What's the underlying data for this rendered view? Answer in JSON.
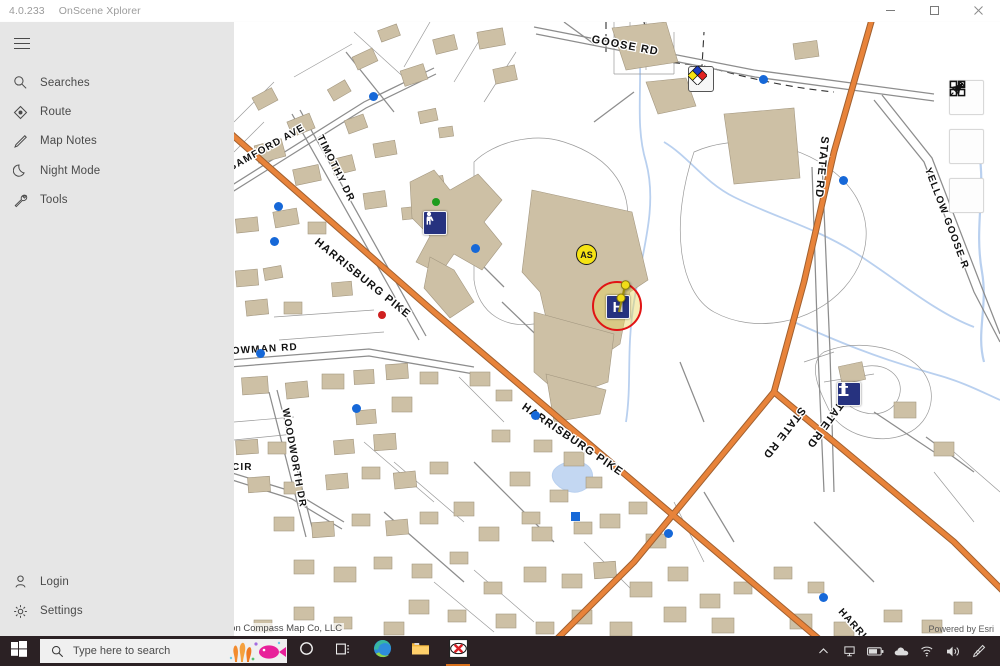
{
  "window": {
    "version": "4.0.233",
    "title": "OnScene Xplorer",
    "controls": {
      "minimize": "minimize-button",
      "maximize": "maximize-button",
      "close": "close-button"
    }
  },
  "sidebar": {
    "menu_toggle": "hamburger-menu",
    "items": [
      {
        "label": "Searches",
        "icon": "search-icon"
      },
      {
        "label": "Route",
        "icon": "route-icon"
      },
      {
        "label": "Map Notes",
        "icon": "pencil-icon"
      },
      {
        "label": "Night Mode",
        "icon": "moon-icon"
      },
      {
        "label": "Tools",
        "icon": "wrench-icon"
      }
    ],
    "bottom_items": [
      {
        "label": "Login",
        "icon": "person-icon"
      },
      {
        "label": "Settings",
        "icon": "gear-icon"
      }
    ]
  },
  "map": {
    "controls": [
      {
        "name": "locate-button",
        "icon": "navigation-arrow-icon"
      },
      {
        "name": "layers-button",
        "icon": "grid-squares-icon"
      },
      {
        "name": "pin-button",
        "icon": "pushpin-icon"
      }
    ],
    "attribution": "ron Compass Map Co, LLC",
    "powered_by": "Powered by Esri",
    "street_labels": [
      "GOOSE RD",
      "BAMFORD AVE",
      "TIMOTHY DR",
      "HARRISBURG PIKE",
      "STATE RD",
      "YELLOW GOOSE RD",
      "OWMAN RD",
      "WOODWORTH DR",
      "CIR",
      "HARRIS"
    ],
    "markers": {
      "hazmat_label": "NFPA-hazard-diamond",
      "assembly_label": "AS",
      "hospital_label": "H",
      "hydrant_label": "fire-hydrant-icon",
      "utility_label": "utility-shutoff-icon"
    },
    "colors": {
      "road_primary": "#e8833a",
      "building": "#cdc0a5",
      "water": "#b9d0ef",
      "marker_blue": "#1668d8",
      "marker_yellow": "#f5e313",
      "highlight_red": "#e11414"
    }
  },
  "taskbar": {
    "start_label": "start-button",
    "search_placeholder": "Type here to search",
    "items": [
      {
        "name": "cortana-button",
        "icon": "circle-icon"
      },
      {
        "name": "task-view-button",
        "icon": "task-view-icon"
      },
      {
        "name": "edge-button",
        "icon": "edge-icon"
      },
      {
        "name": "file-explorer-button",
        "icon": "folder-icon"
      },
      {
        "name": "onscene-xplorer-button",
        "icon": "app-icon"
      }
    ],
    "tray": [
      {
        "name": "show-hidden-icons",
        "icon": "chevron-up-icon"
      },
      {
        "name": "display-settings",
        "icon": "monitor-icon"
      },
      {
        "name": "battery-status",
        "icon": "battery-icon"
      },
      {
        "name": "onedrive-status",
        "icon": "cloud-icon"
      },
      {
        "name": "network-status",
        "icon": "wifi-icon"
      },
      {
        "name": "volume-control",
        "icon": "speaker-icon"
      },
      {
        "name": "pen-workspace",
        "icon": "pen-icon"
      }
    ]
  }
}
